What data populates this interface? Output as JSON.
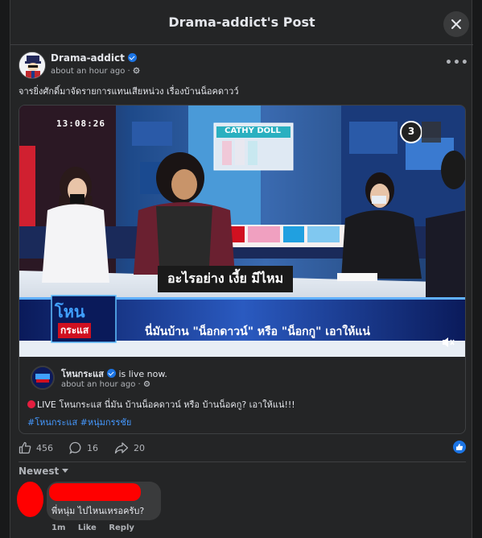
{
  "header": {
    "title": "Drama-addict's Post"
  },
  "post": {
    "author": "Drama-addict",
    "time": "about an hour ago",
    "text": "จารยิ่งศักดิ์มาจัดรายการแทนเสียหน่วง เรื่องบ้านน็อคดาวว์"
  },
  "video": {
    "timestamp": "13:08:26",
    "sponsor": "CATHY DOLL",
    "channel_number": "3",
    "subtitle": "อะไรอย่าง เงี้ย มีไหม",
    "show_logo_top": "โหน",
    "show_logo_bottom": "กระแส",
    "headline": "นี่มันบ้าน \"น็อกดาวน์\" หรือ \"น็อกกู\" เอาให้แน่"
  },
  "shared": {
    "name": "โหนกระแส",
    "status": "is live now.",
    "time": "about an hour ago",
    "text": "LIVE โหนกระแส นี่มัน บ้านน็อคดาวน์ หรือ บ้านน็อคกู? เอาให้แน่!!!",
    "hashtags": "#โหนกระแส #หนุ่มกรรชัย"
  },
  "reactions": {
    "likes": "456",
    "comments": "16",
    "shares": "20"
  },
  "comments": {
    "sort_label": "Newest",
    "items": [
      {
        "text": "พี่หนุ่ม ไปไหนเหรอครับ?",
        "time": "1m",
        "like": "Like",
        "reply": "Reply"
      }
    ]
  },
  "colors": {
    "background": "#242526",
    "accent": "#1b74e4",
    "redaction": "#ff0000"
  }
}
